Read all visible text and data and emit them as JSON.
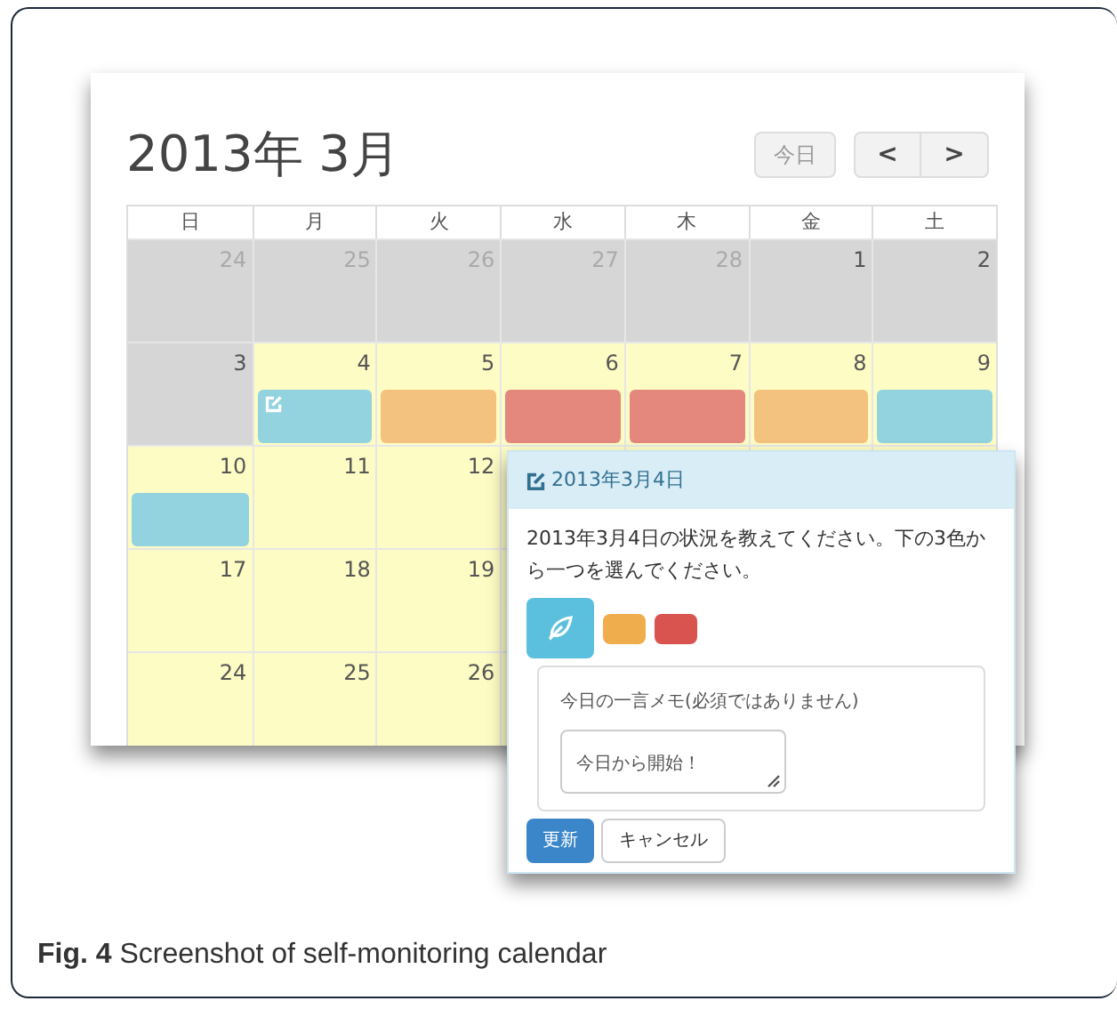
{
  "calendar": {
    "title": "2013年 3月",
    "today_button": "今日",
    "prev_button": "<",
    "next_button": ">",
    "weekdays": [
      "日",
      "月",
      "火",
      "水",
      "木",
      "金",
      "土"
    ],
    "weeks": [
      [
        {
          "day": "24",
          "kind": "other"
        },
        {
          "day": "25",
          "kind": "other"
        },
        {
          "day": "26",
          "kind": "other"
        },
        {
          "day": "27",
          "kind": "other"
        },
        {
          "day": "28",
          "kind": "other"
        },
        {
          "day": "1",
          "kind": "inactive"
        },
        {
          "day": "2",
          "kind": "inactive"
        }
      ],
      [
        {
          "day": "3",
          "kind": "inactive"
        },
        {
          "day": "4",
          "kind": "active",
          "color": "#93d3df",
          "editing": true
        },
        {
          "day": "5",
          "kind": "active",
          "color": "#f3c27e"
        },
        {
          "day": "6",
          "kind": "active",
          "color": "#e4887e"
        },
        {
          "day": "7",
          "kind": "active",
          "color": "#e4887e"
        },
        {
          "day": "8",
          "kind": "active",
          "color": "#f3c27e"
        },
        {
          "day": "9",
          "kind": "active",
          "color": "#93d3df"
        }
      ],
      [
        {
          "day": "10",
          "kind": "active",
          "color": "#93d3df"
        },
        {
          "day": "11",
          "kind": "active"
        },
        {
          "day": "12",
          "kind": "active"
        }
      ],
      [
        {
          "day": "17",
          "kind": "active"
        },
        {
          "day": "18",
          "kind": "active"
        },
        {
          "day": "19",
          "kind": "active"
        }
      ],
      [
        {
          "day": "24",
          "kind": "active"
        },
        {
          "day": "25",
          "kind": "active"
        },
        {
          "day": "26",
          "kind": "active"
        }
      ]
    ]
  },
  "popup": {
    "title": "2013年3月4日",
    "message": "2013年3月4日の状況を教えてください。下の3色から一つを選んでください。",
    "choices": [
      {
        "color": "#5bc0de",
        "selected": true
      },
      {
        "color": "#f0ad4e",
        "selected": false
      },
      {
        "color": "#d9534f",
        "selected": false
      }
    ],
    "memo_label": "今日の一言メモ(必須ではありません)",
    "memo_value": "今日から開始！",
    "update_button": "更新",
    "cancel_button": "キャンセル"
  },
  "caption": "**Fig. 4** Screenshot of self-monitoring calendar"
}
